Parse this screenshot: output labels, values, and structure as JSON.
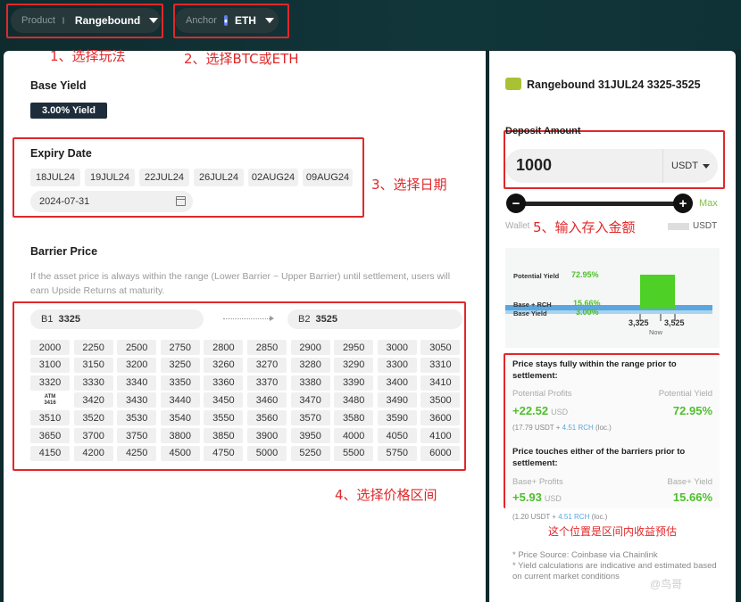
{
  "header": {
    "product_label": "Product",
    "product_value": "Rangebound",
    "anchor_label": "Anchor",
    "anchor_value": "ETH"
  },
  "annotations": {
    "a1": "1、选择玩法",
    "a2": "2、选择BTC或ETH",
    "a3": "3、选择日期",
    "a4": "4、选择价格区间",
    "a5": "5、输入存入金额",
    "a6": "这个位置是区间内收益预估"
  },
  "base_yield": {
    "title": "Base Yield",
    "badge": "3.00% Yield"
  },
  "expiry": {
    "title": "Expiry Date",
    "dates": [
      "18JUL24",
      "19JUL24",
      "22JUL24",
      "26JUL24",
      "02AUG24",
      "09AUG24"
    ],
    "selected": "2024-07-31"
  },
  "barrier": {
    "title": "Barrier Price",
    "description": "If the asset price is always within the range (Lower Barrier ~ Upper Barrier) until settlement, users will earn Upside Returns at maturity.",
    "b1_label": "B1",
    "b1_value": "3325",
    "b2_label": "B2",
    "b2_value": "3525",
    "atm_label": "ATM",
    "atm_value": "3416",
    "grid": [
      [
        "2000",
        "2250",
        "2500",
        "2750",
        "2800",
        "2850",
        "2900",
        "2950",
        "3000",
        "3050"
      ],
      [
        "3100",
        "3150",
        "3200",
        "3250",
        "3260",
        "3270",
        "3280",
        "3290",
        "3300",
        "3310"
      ],
      [
        "3320",
        "3330",
        "3340",
        "3350",
        "3360",
        "3370",
        "3380",
        "3390",
        "3400",
        "3410"
      ],
      [
        "ATM",
        "3420",
        "3430",
        "3440",
        "3450",
        "3460",
        "3470",
        "3480",
        "3490",
        "3500"
      ],
      [
        "3510",
        "3520",
        "3530",
        "3540",
        "3550",
        "3560",
        "3570",
        "3580",
        "3590",
        "3600"
      ],
      [
        "3650",
        "3700",
        "3750",
        "3800",
        "3850",
        "3900",
        "3950",
        "4000",
        "4050",
        "4100"
      ],
      [
        "4150",
        "4200",
        "4250",
        "4500",
        "4750",
        "5000",
        "5250",
        "5500",
        "5750",
        "6000"
      ]
    ]
  },
  "right": {
    "product_title": "Rangebound 31JUL24 3325-3525",
    "deposit_title": "Deposit Amount",
    "deposit_value": "1000",
    "deposit_unit": "USDT",
    "max_label": "Max",
    "wallet_label": "Wallet",
    "wallet_unit": "USDT",
    "chart": {
      "potential_label": "Potential Yield",
      "potential_value": "72.95%",
      "base_rch_label": "Base + RCH",
      "base_rch_value": "15.66%",
      "base_label": "Base Yield",
      "base_value": "3.00%",
      "lower": "3,325",
      "upper": "3,525",
      "now": "Now"
    },
    "within": {
      "title": "Price stays fully within the range prior to settlement:",
      "profits_label": "Potential Profits",
      "yield_label": "Potential Yield",
      "profits_value": "+22.52",
      "profits_unit": "USD",
      "yield_value": "72.95%",
      "breakdown_usdt": "(17.79 USDT + ",
      "breakdown_rch": "4.51 RCH",
      "breakdown_end": " (loc.)"
    },
    "touch": {
      "title": "Price touches either of the barriers prior to settlement:",
      "profits_label": "Base+ Profits",
      "yield_label": "Base+ Yield",
      "profits_value": "+5.93",
      "profits_unit": "USD",
      "yield_value": "15.66%",
      "breakdown_usdt": "(1.20 USDT + ",
      "breakdown_rch": "4.51 RCH",
      "breakdown_end": " (loc.)"
    },
    "notes": [
      "* Price Source: Coinbase via Chainlink",
      "* Yield calculations are indicative and estimated based on current market conditions"
    ]
  },
  "watermark": "@鸟哥"
}
